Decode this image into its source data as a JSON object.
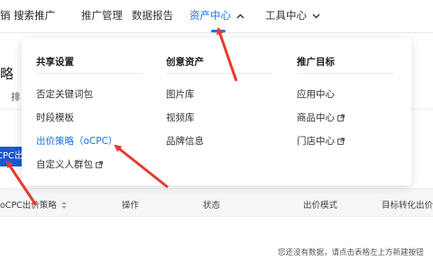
{
  "topnav": {
    "brand": "销 搜索推广",
    "items": [
      {
        "label": "推广管理"
      },
      {
        "label": "数据报告"
      },
      {
        "label": "资产中心"
      },
      {
        "label": "工具中心"
      }
    ],
    "active_index": 2
  },
  "page": {
    "title_partial": "略（",
    "tab_partial": "排",
    "button_partial": "CPC出",
    "table_headers": [
      "oCPC出价策略",
      "操作",
      "状态",
      "出价模式",
      "目标转化出价"
    ],
    "empty_text": "您还没有数据，请点击表格左上方新建按钮"
  },
  "dropdown": {
    "columns": [
      {
        "heading": "共享设置",
        "items": [
          {
            "label": "否定关键词包",
            "external": false
          },
          {
            "label": "时段模板",
            "external": false
          },
          {
            "label": "出价策略（oCPC）",
            "external": false,
            "highlight": true
          },
          {
            "label": "自定义人群包",
            "external": true
          }
        ]
      },
      {
        "heading": "创意资产",
        "items": [
          {
            "label": "图片库",
            "external": false
          },
          {
            "label": "视频库",
            "external": false
          },
          {
            "label": "品牌信息",
            "external": false
          }
        ]
      },
      {
        "heading": "推广目标",
        "items": [
          {
            "label": "应用中心",
            "external": false
          },
          {
            "label": "商品中心",
            "external": true
          },
          {
            "label": "门店中心",
            "external": true
          }
        ]
      }
    ]
  },
  "colors": {
    "accent": "#1a73e8",
    "button": "#1a57d6",
    "annotation": "#e8392f"
  }
}
